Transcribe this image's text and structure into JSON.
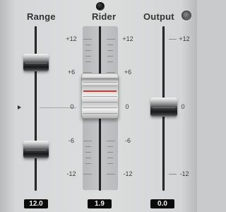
{
  "headers": {
    "range": "Range",
    "rider": "Rider",
    "output": "Output"
  },
  "rider_scale": {
    "left": [
      "+12",
      "+6",
      "0",
      "-6",
      "-12"
    ],
    "right": [
      "+12",
      "+6",
      "0",
      "-6",
      "-12"
    ]
  },
  "output_scale": [
    "+12",
    "0",
    "-12"
  ],
  "values": {
    "range": "12.0",
    "rider": "1.9",
    "output": "0.0"
  },
  "colors": {
    "panel_bg": "#d9dada",
    "rider_red_line": "#c23a3a",
    "value_box_bg": "#0b0b0b",
    "value_text": "#f2f2f2"
  },
  "icons": {
    "rider_indicator": "black-ring-led",
    "output_indicator": "gray-ring-led",
    "range_marker": "triangle-right-marker"
  }
}
